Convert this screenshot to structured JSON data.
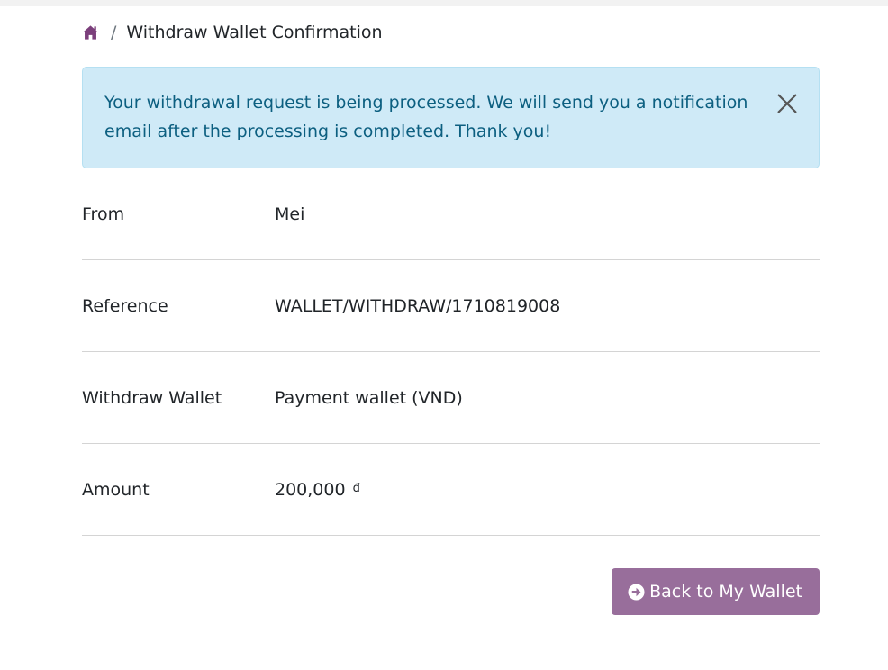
{
  "breadcrumb": {
    "home_icon": "home-icon",
    "separator": "/",
    "current": "Withdraw Wallet Confirmation"
  },
  "alert": {
    "message": "Your withdrawal request is being processed. We will send you a notification email after the processing is completed. Thank you!",
    "close_icon": "close-icon"
  },
  "details": [
    {
      "label": "From",
      "value": "Mei"
    },
    {
      "label": "Reference",
      "value": "WALLET/WITHDRAW/1710819008"
    },
    {
      "label": "Withdraw Wallet",
      "value": "Payment wallet (VND)"
    },
    {
      "label": "Amount",
      "value": "200,000",
      "currency": "₫"
    }
  ],
  "actions": {
    "back_label": "Back to My Wallet",
    "back_icon": "arrow-circle-right-icon"
  },
  "colors": {
    "brand": "#986e9b",
    "alert_bg": "#cfeaf7",
    "alert_text": "#0c5f80",
    "home_icon": "#7b3f7b"
  }
}
